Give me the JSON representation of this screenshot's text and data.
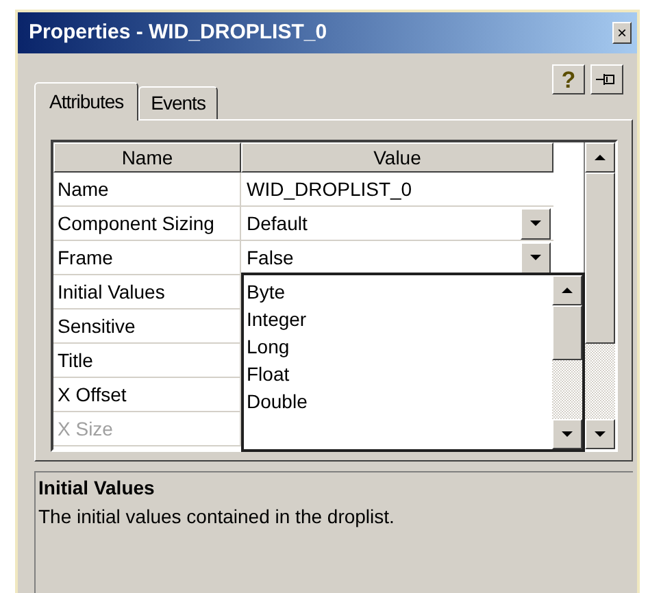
{
  "window": {
    "title": "Properties - WID_DROPLIST_0",
    "close_glyph": "×"
  },
  "toolbar": {
    "help_glyph": "?"
  },
  "tabs": [
    {
      "label": "Attributes",
      "selected": true
    },
    {
      "label": "Events",
      "selected": false
    }
  ],
  "grid": {
    "columns": [
      "Name",
      "Value"
    ],
    "rows": [
      {
        "name": "Name",
        "value": "WID_DROPLIST_0",
        "kind": "text",
        "disabled": false
      },
      {
        "name": "Component Sizing",
        "value": "Default",
        "kind": "dropdown",
        "disabled": false
      },
      {
        "name": "Frame",
        "value": "False",
        "kind": "dropdown",
        "disabled": false
      },
      {
        "name": "Initial Values",
        "disabled": false
      },
      {
        "name": "Sensitive",
        "disabled": false
      },
      {
        "name": "Title",
        "disabled": false
      },
      {
        "name": "X Offset",
        "disabled": false
      },
      {
        "name": "X Size",
        "disabled": true
      }
    ]
  },
  "open_list": {
    "items": [
      "Byte",
      "Integer",
      "Long",
      "Float",
      "Double"
    ]
  },
  "description": {
    "title": "Initial Values",
    "text": "The initial values contained in the droplist."
  }
}
